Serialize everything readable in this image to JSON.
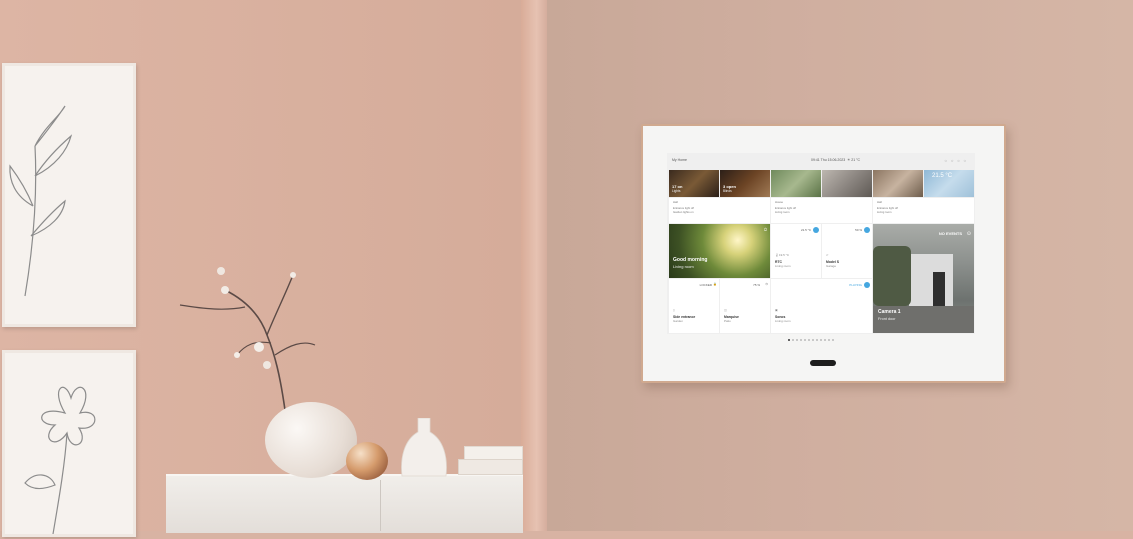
{
  "screen": {
    "topbar": {
      "home_label": "My Home",
      "datetime": "09:41 Thu 15.06.2023",
      "weather": "21 °C",
      "icons": [
        "bell-icon",
        "clock-icon",
        "user-icon",
        "gear-icon"
      ]
    },
    "scenes": [
      {
        "title": "17 on",
        "subtitle": "Lights"
      },
      {
        "title": "3 open",
        "subtitle": "Blinds"
      },
      {
        "title": "",
        "subtitle": ""
      },
      {
        "title": "",
        "subtitle": ""
      },
      {
        "title": "",
        "subtitle": ""
      },
      {
        "title": "21.5 °C",
        "subtitle": ""
      }
    ],
    "status_rows": [
      {
        "label": "Hall",
        "line1": "Entrance light off",
        "line2": "Garden lights on"
      },
      {
        "label": "House",
        "line1": "Entrance light off",
        "line2": "Living room"
      },
      {
        "label": "Hall",
        "line1": "Entrance light off",
        "line2": "Living room"
      }
    ],
    "greeting": {
      "title": "Good morning",
      "subtitle": "Living room"
    },
    "climate": {
      "setpoint": "21.5 °C",
      "value": "19.5 °C",
      "name": "RTC",
      "room": "Living room"
    },
    "blind": {
      "position": "50 %",
      "name": "Model S",
      "room": "Garage"
    },
    "camera": {
      "status": "NO EVENTS",
      "name": "Camera 1",
      "location": "Front door"
    },
    "lock": {
      "state": "LOCKED",
      "name": "Side entrance",
      "room": "Garden"
    },
    "dimmer": {
      "level": "75 %",
      "name": "Marquise",
      "room": "Patio"
    },
    "audio": {
      "state": "PLAYING",
      "name": "Sonos",
      "room": "Living room"
    },
    "page_dots": {
      "count": 12,
      "active": 0
    },
    "accent": "#45a7e0"
  }
}
